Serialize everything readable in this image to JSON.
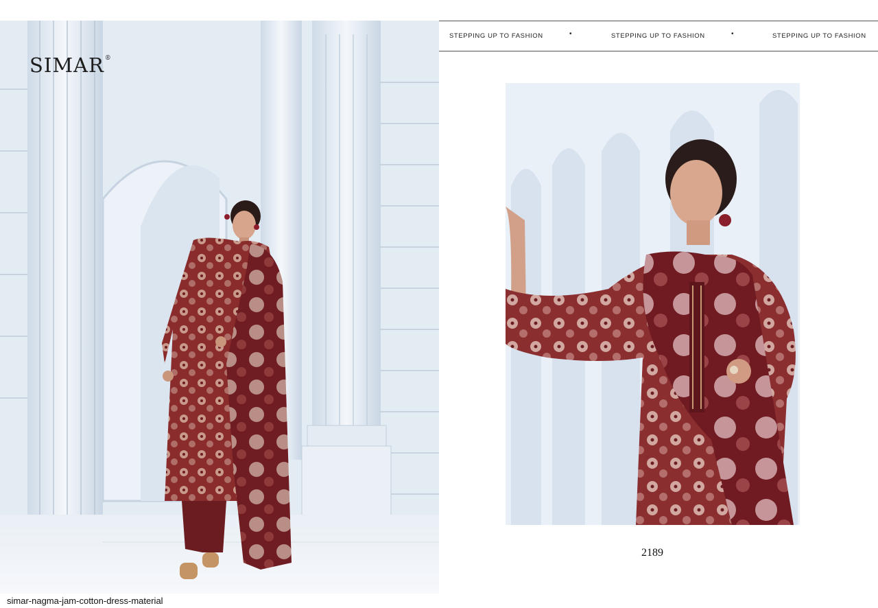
{
  "brand": {
    "name": "SIMAR",
    "mark": "®"
  },
  "banner": {
    "taglines": [
      "STEPPING UP TO FASHION",
      "STEPPING UP TO FASHION",
      "STEPPING UP TO FASHION"
    ],
    "separator": "•"
  },
  "product": {
    "design_number": "2189"
  },
  "caption": "simar-nagma-jam-cotton-dress-material",
  "colors": {
    "fabric": "#7a1f24",
    "fabric_light": "#b77b75",
    "background": "#e6edf5"
  }
}
